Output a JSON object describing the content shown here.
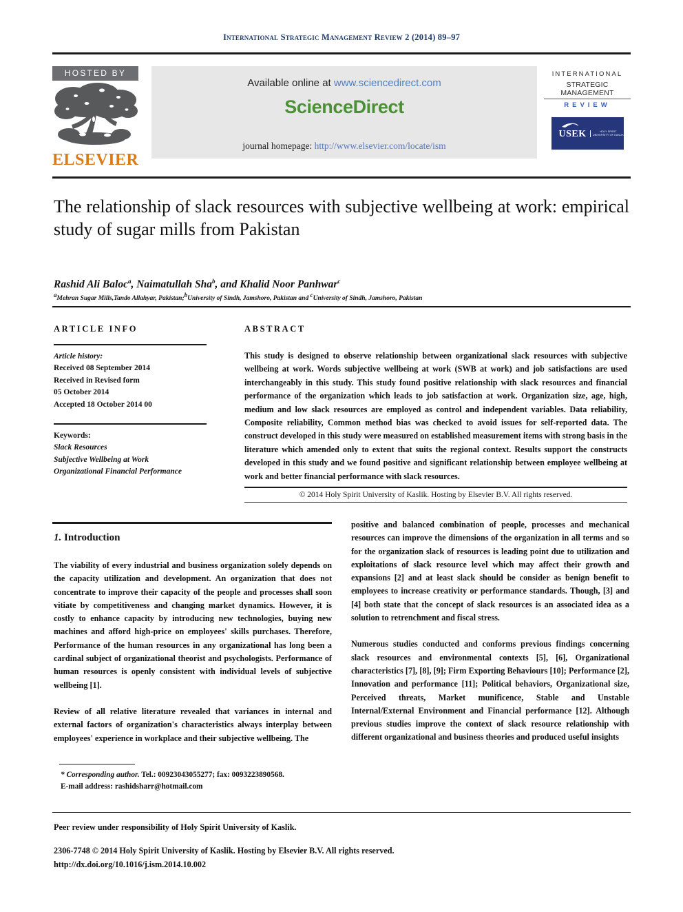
{
  "running_head": "International Strategic Management Review 2 (2014) 89–97",
  "masthead": {
    "hosted_by": "HOSTED BY",
    "publisher_wordmark": "ELSEVIER",
    "available_online_prefix": "Available online at ",
    "available_online_link": "www.sciencedirect.com",
    "sciencedirect_logo": "ScienceDirect",
    "homepage_prefix": "journal homepage: ",
    "homepage_link": "http://www.elsevier.com/locate/ism",
    "journal_logo": {
      "line1": "INTERNATIONAL",
      "line2": "STRATEGIC MANAGEMENT",
      "line3": "REVIEW",
      "publisher_box_word": "USEK",
      "publisher_box_sub": "HOLY SPIRIT UNIVERSITY OF KASLIK"
    },
    "colors": {
      "running_head": "#1d3a6b",
      "elsevier_orange": "#d97b16",
      "sciencedirect_green": "#4a9034",
      "link_blue": "#4f7fbf",
      "usek_navy": "#25377a",
      "hosted_banner_gray": "#6d6e71",
      "banner_background": "#e7e7e7"
    }
  },
  "title": "The relationship of slack resources with subjective wellbeing at work: empirical study of sugar mills from Pakistan",
  "authors": "Rashid Ali Baloc<sup>a</sup>, Naimatullah Sha<sup>b</sup>, and Khalid Noor Panhwar<sup>c</sup>",
  "affiliations": "<sup>a</sup>Mehran Sugar Mills,Tando Allahyar, Pakistan;<sup>b</sup>University of Sindh, Jamshoro, Pakistan and <sup>c</sup>University of Sindh, Jamshoro, Pakistan",
  "article_info": {
    "heading": "ARTICLE INFO",
    "history_label": "Article history:",
    "history": [
      "Received 08 September 2014",
      "Received in Revised form",
      "05 October 2014",
      "Accepted 18 October 2014 00"
    ],
    "keywords_label": "Keywords:",
    "keywords": [
      "Slack Resources",
      "Subjective Wellbeing at Work",
      "Organizational Financial Performance"
    ]
  },
  "abstract": {
    "heading": "ABSTRACT",
    "text": "This study is designed to observe relationship between organizational slack resources with subjective wellbeing at work. Words subjective wellbeing at work (SWB at work) and job satisfactions are used interchangeably in this study. This study found positive relationship with slack resources and financial performance of the organization which leads to job satisfaction at work. Organization size, age, high, medium and low slack resources are employed as control and independent variables. Data reliability, Composite reliability, Common method bias was checked to avoid issues for self-reported data. The construct developed in this study were measured on established measurement items with strong basis in the literature which amended only to extent that suits the regional context. Results support the constructs developed in this study and we found positive and significant relationship between employee wellbeing at work and better financial performance with slack resources.",
    "copyright": "© 2014 Holy Spirit University of Kaslik. Hosting by Elsevier B.V. All rights reserved."
  },
  "section": {
    "number": "1.",
    "heading": "Introduction"
  },
  "body": {
    "left_paragraphs": [
      "The viability of every industrial and business organization solely depends on the capacity utilization and development. An organization that does not concentrate to improve their capacity of the people and processes shall soon vitiate by competitiveness and changing market dynamics. However, it is costly to enhance capacity by introducing new technologies, buying new machines and afford high-price on employees' skills purchases. Therefore, Performance of the human resources in any organizational has long been a cardinal subject of organizational theorist and psychologists. Performance of human resources is openly consistent with individual levels of subjective wellbeing [1].",
      "Review of all relative literature revealed that variances in internal and external factors of organization's characteristics always interplay between employees' experience in workplace and their subjective wellbeing. The"
    ],
    "right_paragraphs": [
      "positive and balanced combination of people, processes and mechanical resources can improve the dimensions of the organization in all terms and so for the organization slack of resources is leading point due to utilization and exploitations of slack resource level which may affect their growth and expansions [2] and at least slack should be consider as benign benefit to employees to increase creativity or performance standards. Though, [3] and [4] both state that the concept of slack resources is an associated idea as a solution to retrenchment and fiscal stress.",
      "Numerous studies conducted and conforms previous findings concerning slack resources and environmental contexts [5], [6], Organizational characteristics [7], [8], [9]; Firm Exporting Behaviours [10]; Performance [2], Innovation and performance [11]; Political behaviors, Organizational size, Perceived threats, Market munificence, Stable and Unstable Internal/External Environment and Financial performance [12]. Although previous studies improve the context of slack resource relationship with different organizational and business theories and produced useful insights"
    ]
  },
  "footnote": {
    "corresponding_label": "* Corresponding author.",
    "contact": " Tel.: 00923043055277; fax: 0093223890568.",
    "email_label": "E-mail address: ",
    "email": "rashidsharr@hotmail.com"
  },
  "footer": {
    "peer_review": "Peer review under responsibility of Holy Spirit University of Kaslik.",
    "issn_line": "2306-7748 © 2014 Holy Spirit University of Kaslik. Hosting by Elsevier B.V. All rights reserved.",
    "doi": "http://dx.doi.org/10.1016/j.ism.2014.10.002"
  }
}
